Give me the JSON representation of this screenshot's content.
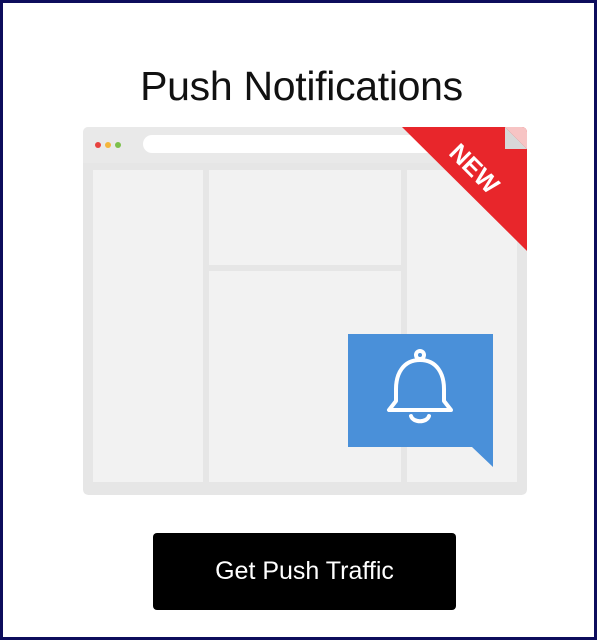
{
  "card": {
    "title": "Push Notifications",
    "badge_label": "NEW",
    "cta_label": "Get Push Traffic"
  },
  "icons": {
    "window_dots": [
      "red-dot-icon",
      "yellow-dot-icon",
      "green-dot-icon"
    ],
    "notification": "bell-icon"
  },
  "colors": {
    "frame_border": "#0d0d5c",
    "badge_red": "#e8262b",
    "notification_blue": "#4a90d9",
    "button_bg": "#000000",
    "button_text": "#ffffff",
    "dot_red": "#e8423f",
    "dot_yellow": "#f4b63c",
    "dot_green": "#7cc04b"
  }
}
